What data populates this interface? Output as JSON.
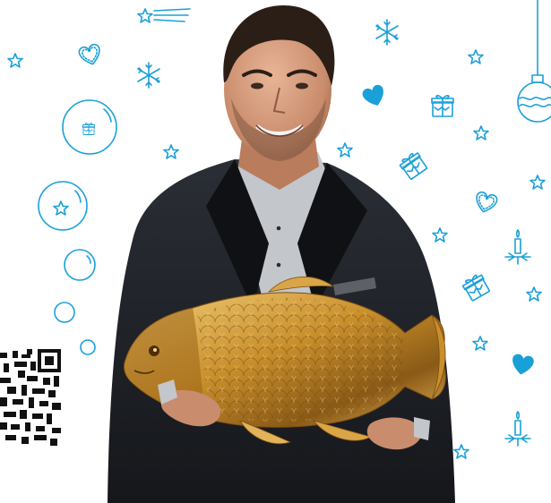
{
  "image": {
    "background_color": "#ffffff",
    "accent_color": "#1aa0d8",
    "gold_color": "#c9922f",
    "suit_color": "#1c1f24",
    "shirt_color": "#b9bcc0",
    "subject": "man-holding-golden-carp",
    "decorations": [
      "star-icon",
      "shooting-star-icon",
      "heart-icon",
      "snowflake-icon",
      "gift-icon",
      "bauble-icon",
      "candle-icon",
      "bubble-icon",
      "qr-code"
    ]
  }
}
